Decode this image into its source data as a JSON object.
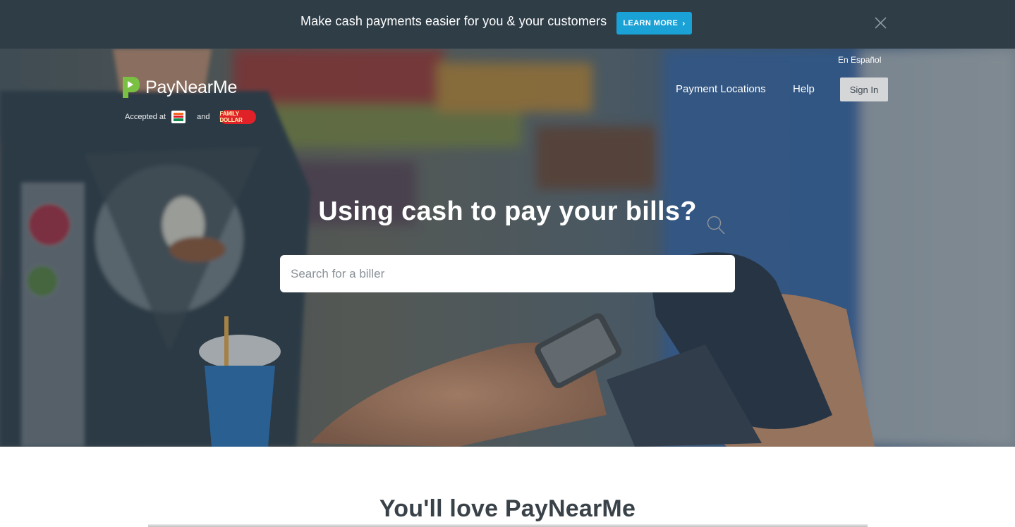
{
  "promo": {
    "text": "Make cash payments easier for you & your customers",
    "button_label": "LEARN MORE",
    "button_chevron": "›",
    "close_icon": "close-icon",
    "background": "#2f3d47",
    "button_color": "#1aa1d6"
  },
  "header": {
    "brand": "PayNearMe",
    "brand_accent": "#7ac143",
    "accepted_label": "Accepted at",
    "and_label": "and",
    "family_dollar_text": "FAMILY DOLLAR",
    "language_link": "En Español",
    "nav": {
      "payment_locations": "Payment Locations",
      "help": "Help",
      "sign_in": "Sign In"
    }
  },
  "hero": {
    "title": "Using cash to pay your bills?",
    "search_placeholder": "Search for a biller",
    "search_icon": "search-icon"
  },
  "section": {
    "title": "You'll love PayNearMe"
  }
}
